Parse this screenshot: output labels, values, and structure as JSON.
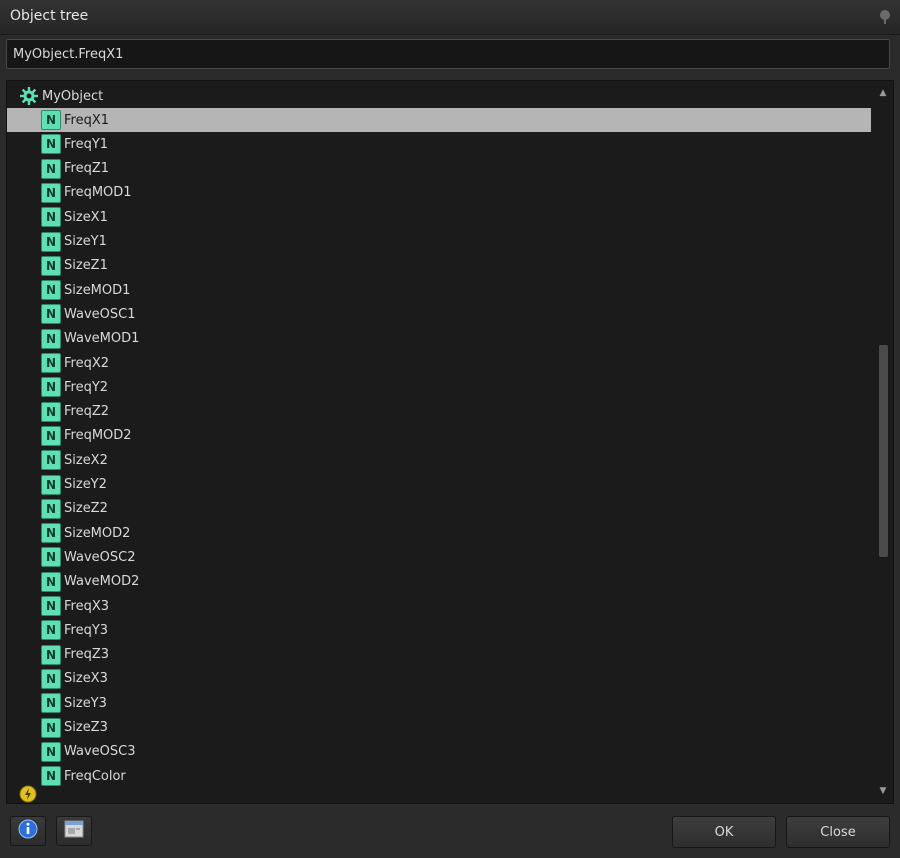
{
  "window": {
    "title": "Object tree",
    "pin_icon": "pin-icon"
  },
  "path_field": {
    "value": "MyObject.FreqX1"
  },
  "tree": {
    "root": {
      "label": "MyObject",
      "icon": "gear-icon"
    },
    "node_icon_letter": "N",
    "selected_index": 0,
    "items": [
      "FreqX1",
      "FreqY1",
      "FreqZ1",
      "FreqMOD1",
      "SizeX1",
      "SizeY1",
      "SizeZ1",
      "SizeMOD1",
      "WaveOSC1",
      "WaveMOD1",
      "FreqX2",
      "FreqY2",
      "FreqZ2",
      "FreqMOD2",
      "SizeX2",
      "SizeY2",
      "SizeZ2",
      "SizeMOD2",
      "WaveOSC2",
      "WaveMOD2",
      "FreqX3",
      "FreqY3",
      "FreqZ3",
      "SizeX3",
      "SizeY3",
      "SizeZ3",
      "WaveOSC3",
      "FreqColor"
    ],
    "extra_item_icon": "lightning-icon"
  },
  "footer": {
    "info_icon": "info-icon",
    "window_icon": "window-icon",
    "ok_label": "OK",
    "close_label": "Close"
  },
  "colors": {
    "node_icon": "#5fe0b4",
    "selection": "#b5b5b5",
    "background": "#1b1b1b"
  }
}
